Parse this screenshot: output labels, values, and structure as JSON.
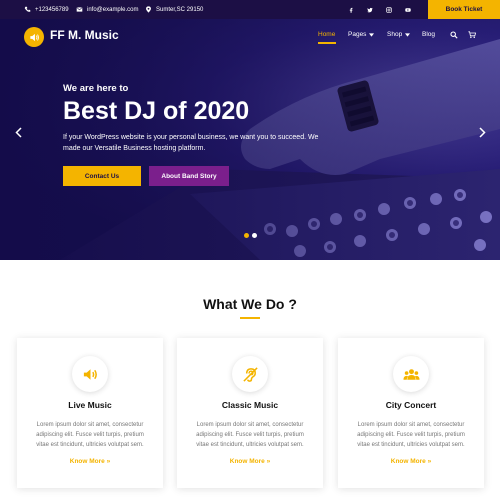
{
  "topbar": {
    "phone": "+123456789",
    "email": "info@example.com",
    "address": "Sumter,SC 29150",
    "social_icons": [
      "facebook-icon",
      "twitter-icon",
      "instagram-icon",
      "youtube-icon"
    ],
    "book_label": "Book Ticket"
  },
  "brand": {
    "name": "FF M. Music",
    "icon": "speaker-icon"
  },
  "nav": {
    "items": [
      {
        "label": "Home",
        "active": true
      },
      {
        "label": "Pages",
        "dropdown": true
      },
      {
        "label": "Shop",
        "dropdown": true
      },
      {
        "label": "Blog"
      }
    ],
    "icons": [
      "search-icon",
      "cart-icon"
    ]
  },
  "hero": {
    "subtitle": "We are here to",
    "title": "Best DJ of 2020",
    "description": "If your WordPress website is your personal business, we want you to succeed. We made our Versatile Business hosting platform.",
    "primary_button": "Contact Us",
    "secondary_button": "About Band Story",
    "slides": 2,
    "active_slide": 1
  },
  "services": {
    "title": "What We Do ?",
    "cards": [
      {
        "icon": "volume-icon",
        "title": "Live Music",
        "text": "Lorem ipsum dolor sit amet, consectetur adipiscing elit. Fusce velit turpis, pretium vitae est tincidunt, ultricies volutpat sem.",
        "link": "Know More »"
      },
      {
        "icon": "hearing-icon",
        "title": "Classic Music",
        "text": "Lorem ipsum dolor sit amet, consectetur adipiscing elit. Fusce velit turpis, pretium vitae est tincidunt, ultricies volutpat sem.",
        "link": "Know More »"
      },
      {
        "icon": "group-icon",
        "title": "City Concert",
        "text": "Lorem ipsum dolor sit amet, consectetur adipiscing elit. Fusce velit turpis, pretium vitae est tincidunt, ultricies volutpat sem.",
        "link": "Know More »"
      }
    ]
  },
  "colors": {
    "topbar_bg": "#1c0f45",
    "accent": "#f4b400",
    "secondary_button": "#7b1f8c",
    "hero_bg": "#1a1250"
  }
}
